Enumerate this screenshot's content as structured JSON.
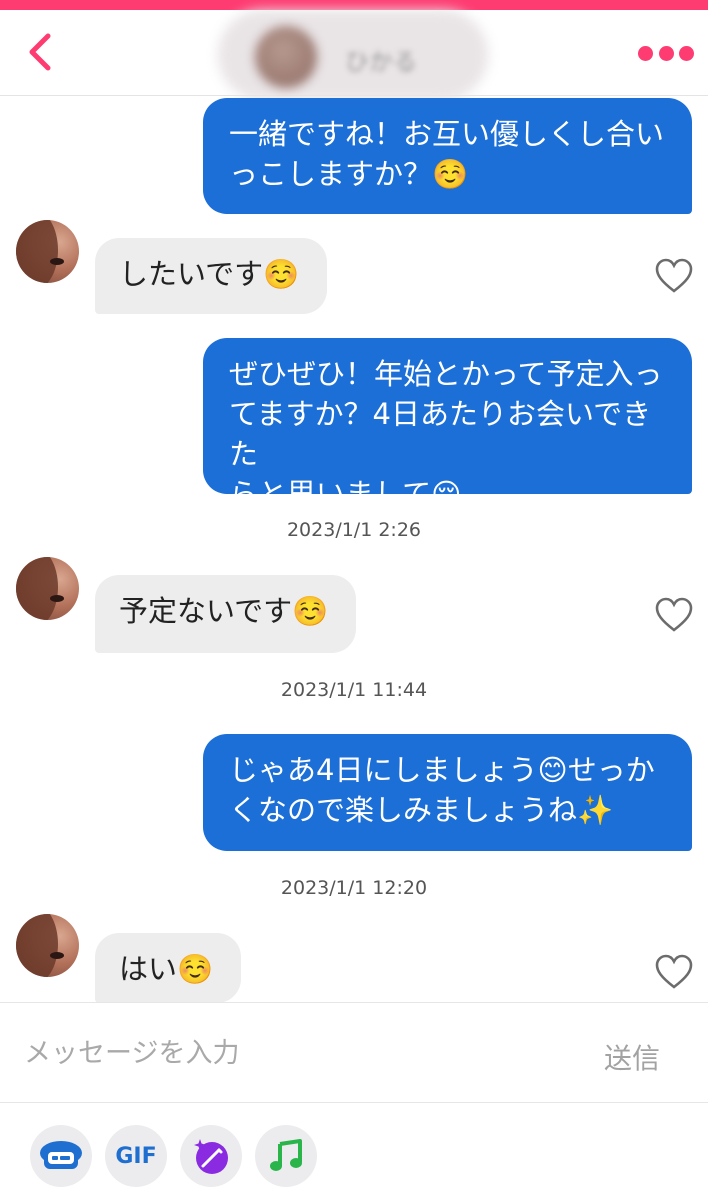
{
  "header": {
    "contact_name": "ひかる"
  },
  "messages": [
    {
      "text": "一緒ですね！お互い優しくし合い",
      "text2": "っこしますか？",
      "emoji": "☺️"
    },
    {
      "text": "したいです",
      "emoji": "☺️"
    },
    {
      "text": "ぜひぜひ！年始とかって予定入っ",
      "text2": "てますか？4日あたりお会いできた",
      "text3": "らと思いまして",
      "emoji": "😌"
    },
    {
      "text": "予定ないです",
      "emoji": "☺️"
    },
    {
      "text": "じゃあ4日にしましょう",
      "emoji": "😊",
      "text_after": "せっか",
      "text2": "くなので楽しみましょうね",
      "emoji2": "✨"
    },
    {
      "text": "はい",
      "emoji": "☺️"
    }
  ],
  "timestamps": [
    "2023/1/1 2:26",
    "2023/1/1 11:44",
    "2023/1/1 12:20"
  ],
  "composer": {
    "placeholder": "メッセージを入力",
    "send_label": "送信"
  },
  "toolbar": {
    "gif_label": "GIF",
    "icons": [
      "sticker-icon",
      "gif-icon",
      "magic-icon",
      "music-icon"
    ]
  },
  "colors": {
    "brand": "#fe3c72",
    "outgoing_bubble": "#1c6fd6",
    "incoming_bubble": "#ededee",
    "gif": "#1f6fd1",
    "magic": "#8a2be2",
    "music": "#2ab54b"
  }
}
